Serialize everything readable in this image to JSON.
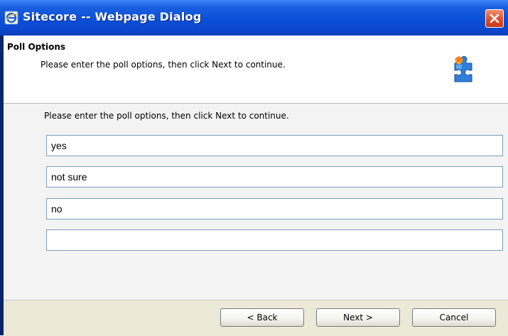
{
  "window": {
    "title": "Sitecore -- Webpage Dialog"
  },
  "header": {
    "title": "Poll Options",
    "subtitle": "Please enter the poll options, then click Next to continue."
  },
  "main": {
    "instruction": "Please enter the poll options, then click Next to continue.",
    "options": [
      {
        "value": "yes"
      },
      {
        "value": "not sure"
      },
      {
        "value": "no"
      },
      {
        "value": ""
      }
    ]
  },
  "footer": {
    "back_label": "< Back",
    "next_label": "Next >",
    "cancel_label": "Cancel"
  },
  "icons": {
    "title": "ie-page-icon",
    "close": "close-icon",
    "header": "puzzle-wizard-icon"
  },
  "colors": {
    "titlebar": "#0a4fd8",
    "close": "#d84c28",
    "body_bg": "#f3f3f3",
    "footer_bg": "#ece9d8"
  }
}
